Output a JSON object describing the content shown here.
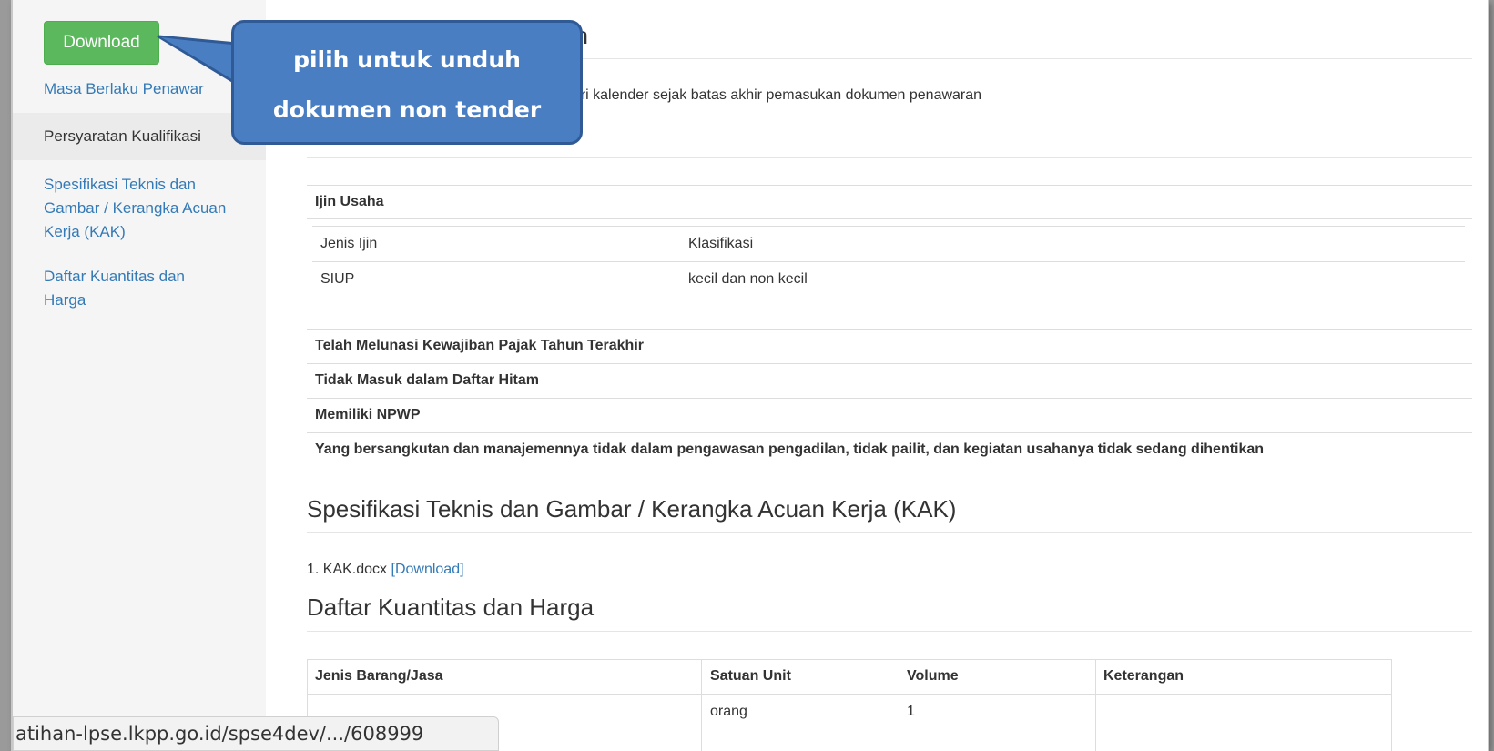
{
  "sidebar": {
    "download_label": "Download",
    "items": [
      {
        "label": "Masa Berlaku Penawar"
      },
      {
        "label": "Persyaratan Kualifikasi"
      },
      {
        "label": "Spesifikasi Teknis dan Gambar / Kerangka Acuan Kerja (KAK)"
      },
      {
        "label": "Daftar Kuantitas dan Harga"
      }
    ]
  },
  "callout": {
    "line1": "pilih untuk unduh",
    "line2": "dokumen non tender"
  },
  "main": {
    "heading_partial": "an",
    "masa_text": "hari kalender sejak batas akhir pemasukan dokumen penawaran",
    "ijin_title": "Ijin Usaha",
    "ijin_headers": [
      "Jenis Ijin",
      "Klasifikasi"
    ],
    "ijin_row": [
      "SIUP",
      "kecil dan non kecil"
    ],
    "requirements": [
      "Telah Melunasi Kewajiban Pajak Tahun Terakhir",
      "Tidak Masuk dalam Daftar Hitam",
      "Memiliki NPWP",
      "Yang bersangkutan dan manajemennya tidak dalam pengawasan pengadilan, tidak pailit, dan kegiatan usahanya tidak sedang dihentikan"
    ],
    "kak_heading": "Spesifikasi Teknis dan Gambar / Kerangka Acuan Kerja (KAK)",
    "kak_file": "1. KAK.docx",
    "kak_download": "[Download]",
    "dkh_heading": "Daftar Kuantitas dan Harga",
    "dkh_headers": [
      "Jenis Barang/Jasa",
      "Satuan Unit",
      "Volume",
      "Keterangan"
    ],
    "dkh_row": [
      "",
      "orang",
      "1",
      ""
    ]
  },
  "statusbar": {
    "url": "atihan-lpse.lkpp.go.id/spse4dev/.../608999"
  }
}
